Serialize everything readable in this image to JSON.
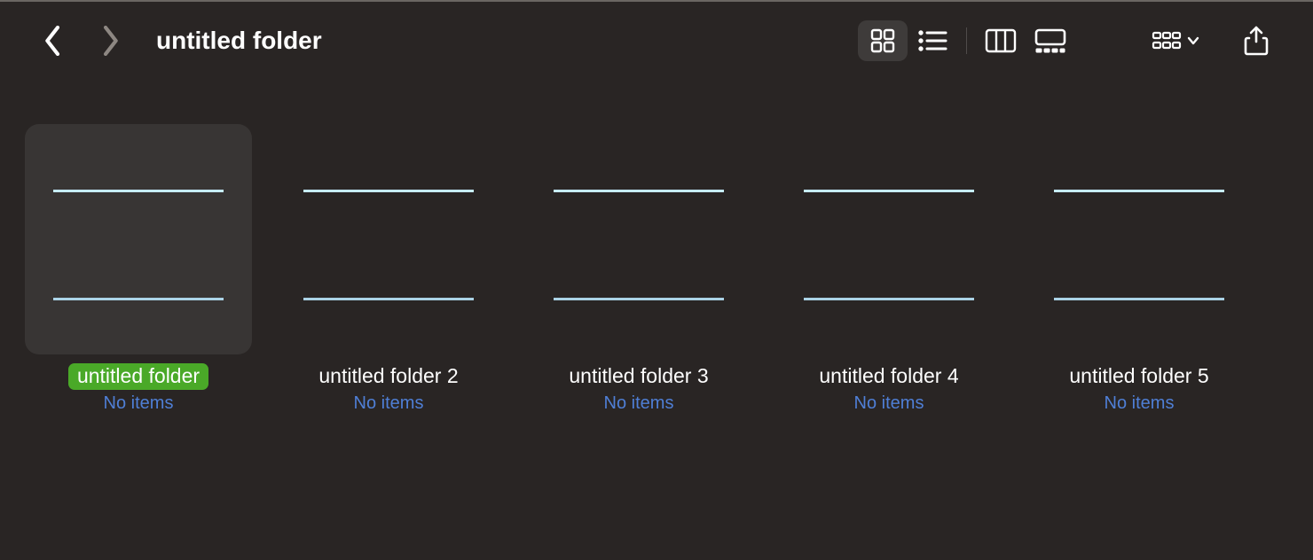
{
  "header": {
    "title": "untitled folder",
    "view_mode": "icons"
  },
  "items": [
    {
      "name": "untitled folder",
      "sub": "No items",
      "selected": true
    },
    {
      "name": "untitled folder 2",
      "sub": "No items",
      "selected": false
    },
    {
      "name": "untitled folder 3",
      "sub": "No items",
      "selected": false
    },
    {
      "name": "untitled folder 4",
      "sub": "No items",
      "selected": false
    },
    {
      "name": "untitled folder 5",
      "sub": "No items",
      "selected": false
    }
  ]
}
